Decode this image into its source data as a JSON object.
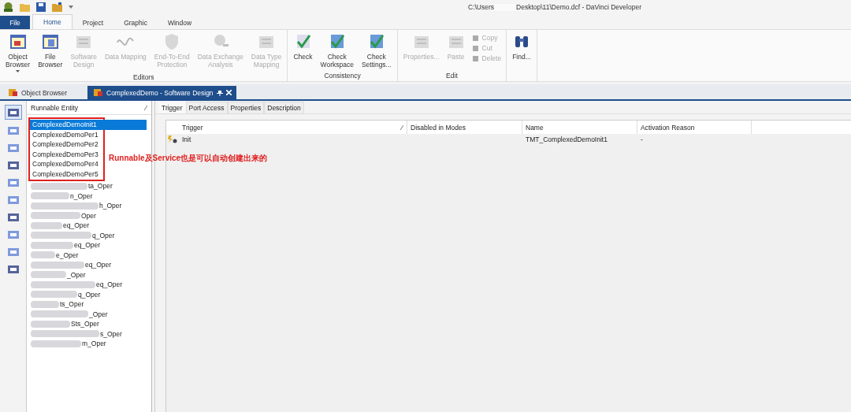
{
  "title_bar": {
    "path_start": "C:\\Users",
    "path_end": "Desktop\\11\\Demo.dcf - DaVinci Developer"
  },
  "ribbon_tabs": [
    {
      "label": "File",
      "kind": "file",
      "selected": false
    },
    {
      "label": "Home",
      "kind": "tab",
      "selected": true
    },
    {
      "label": "Project",
      "kind": "tab",
      "selected": false
    },
    {
      "label": "Graphic",
      "kind": "tab",
      "selected": false
    },
    {
      "label": "Window",
      "kind": "tab",
      "selected": false
    }
  ],
  "ribbon_groups": [
    {
      "label": "Editors",
      "buttons": [
        {
          "lines": [
            "Object",
            "Browser"
          ],
          "dropdown": true,
          "disabled": false
        },
        {
          "lines": [
            "File",
            "Browser"
          ],
          "dropdown": false,
          "disabled": false
        },
        {
          "lines": [
            "Software",
            "Design"
          ],
          "dropdown": false,
          "disabled": true
        },
        {
          "lines": [
            "Data Mapping"
          ],
          "dropdown": false,
          "disabled": true
        },
        {
          "lines": [
            "End-To-End",
            "Protection"
          ],
          "dropdown": false,
          "disabled": true
        },
        {
          "lines": [
            "Data Exchange",
            "Analysis"
          ],
          "dropdown": false,
          "disabled": true
        },
        {
          "lines": [
            "Data Type",
            "Mapping"
          ],
          "dropdown": false,
          "disabled": true
        }
      ]
    },
    {
      "label": "Consistency",
      "buttons": [
        {
          "lines": [
            "Check"
          ],
          "dropdown": false,
          "disabled": false
        },
        {
          "lines": [
            "Check",
            "Workspace"
          ],
          "dropdown": false,
          "disabled": false
        },
        {
          "lines": [
            "Check",
            "Settings..."
          ],
          "dropdown": false,
          "disabled": false
        }
      ]
    },
    {
      "label": "Edit",
      "buttons": [
        {
          "lines": [
            "Properties..."
          ],
          "dropdown": false,
          "disabled": true
        },
        {
          "lines": [
            "Paste"
          ],
          "dropdown": false,
          "disabled": true
        }
      ],
      "small_buttons": [
        {
          "label": "Copy",
          "disabled": true
        },
        {
          "label": "Cut",
          "disabled": true
        },
        {
          "label": "Delete",
          "disabled": true
        }
      ]
    },
    {
      "buttons": [
        {
          "lines": [
            "Find..."
          ],
          "dropdown": false,
          "disabled": false
        }
      ]
    }
  ],
  "doc_tabs": [
    {
      "label": "Object Browser",
      "selected": false
    },
    {
      "label": "ComplexedDemo - Software Design",
      "selected": true
    }
  ],
  "side_tools": [
    {
      "selected": true
    },
    {
      "selected": false
    },
    {
      "selected": false
    },
    {
      "selected": false
    },
    {
      "selected": false
    },
    {
      "selected": false
    },
    {
      "selected": false
    },
    {
      "selected": false
    },
    {
      "selected": false
    },
    {
      "selected": false
    }
  ],
  "list": {
    "header": "Runnable Entity",
    "note": "Runnable及Service也是可以自动创建出来的",
    "items": [
      {
        "label": "ComplexedDemoInit1",
        "selected": true,
        "boxed": true,
        "redacted": false
      },
      {
        "label": "ComplexedDemoPer1",
        "selected": false,
        "boxed": true,
        "redacted": false
      },
      {
        "label": "ComplexedDemoPer2",
        "selected": false,
        "boxed": true,
        "redacted": false
      },
      {
        "label": "ComplexedDemoPer3",
        "selected": false,
        "boxed": true,
        "redacted": false
      },
      {
        "label": "ComplexedDemoPer4",
        "selected": false,
        "boxed": true,
        "redacted": false
      },
      {
        "label": "ComplexedDemoPer5",
        "selected": false,
        "boxed": true,
        "redacted": false
      },
      {
        "label": "ta_Oper",
        "selected": false,
        "redacted": true
      },
      {
        "label": "n_Oper",
        "selected": false,
        "redacted": true
      },
      {
        "label": "h_Oper",
        "selected": false,
        "redacted": true
      },
      {
        "label": "Oper",
        "selected": false,
        "redacted": true
      },
      {
        "label": "eq_Oper",
        "selected": false,
        "redacted": true
      },
      {
        "label": "q_Oper",
        "selected": false,
        "redacted": true
      },
      {
        "label": "eq_Oper",
        "selected": false,
        "redacted": true
      },
      {
        "label": "e_Oper",
        "selected": false,
        "redacted": true
      },
      {
        "label": "eq_Oper",
        "selected": false,
        "redacted": true
      },
      {
        "label": "_Oper",
        "selected": false,
        "redacted": true
      },
      {
        "label": "eq_Oper",
        "selected": false,
        "redacted": true
      },
      {
        "label": "q_Oper",
        "selected": false,
        "redacted": true
      },
      {
        "label": "ts_Oper",
        "selected": false,
        "redacted": true
      },
      {
        "label": "_Oper",
        "selected": false,
        "redacted": true
      },
      {
        "label": "Sts_Oper",
        "selected": false,
        "redacted": true
      },
      {
        "label": "s_Oper",
        "selected": false,
        "redacted": true
      },
      {
        "label": "m_Oper",
        "selected": false,
        "redacted": true
      }
    ]
  },
  "detail_tabs": [
    {
      "label": "Trigger",
      "selected": true
    },
    {
      "label": "Port Access",
      "selected": false
    },
    {
      "label": "Properties",
      "selected": false
    },
    {
      "label": "Description",
      "selected": false
    }
  ],
  "table": {
    "columns": [
      "Trigger",
      "Disabled in Modes",
      "Name",
      "Activation Reason"
    ],
    "rows": [
      {
        "trigger": "Init",
        "name": "TMT_ComplexedDemoInit1",
        "activation_reason": "-"
      }
    ]
  }
}
